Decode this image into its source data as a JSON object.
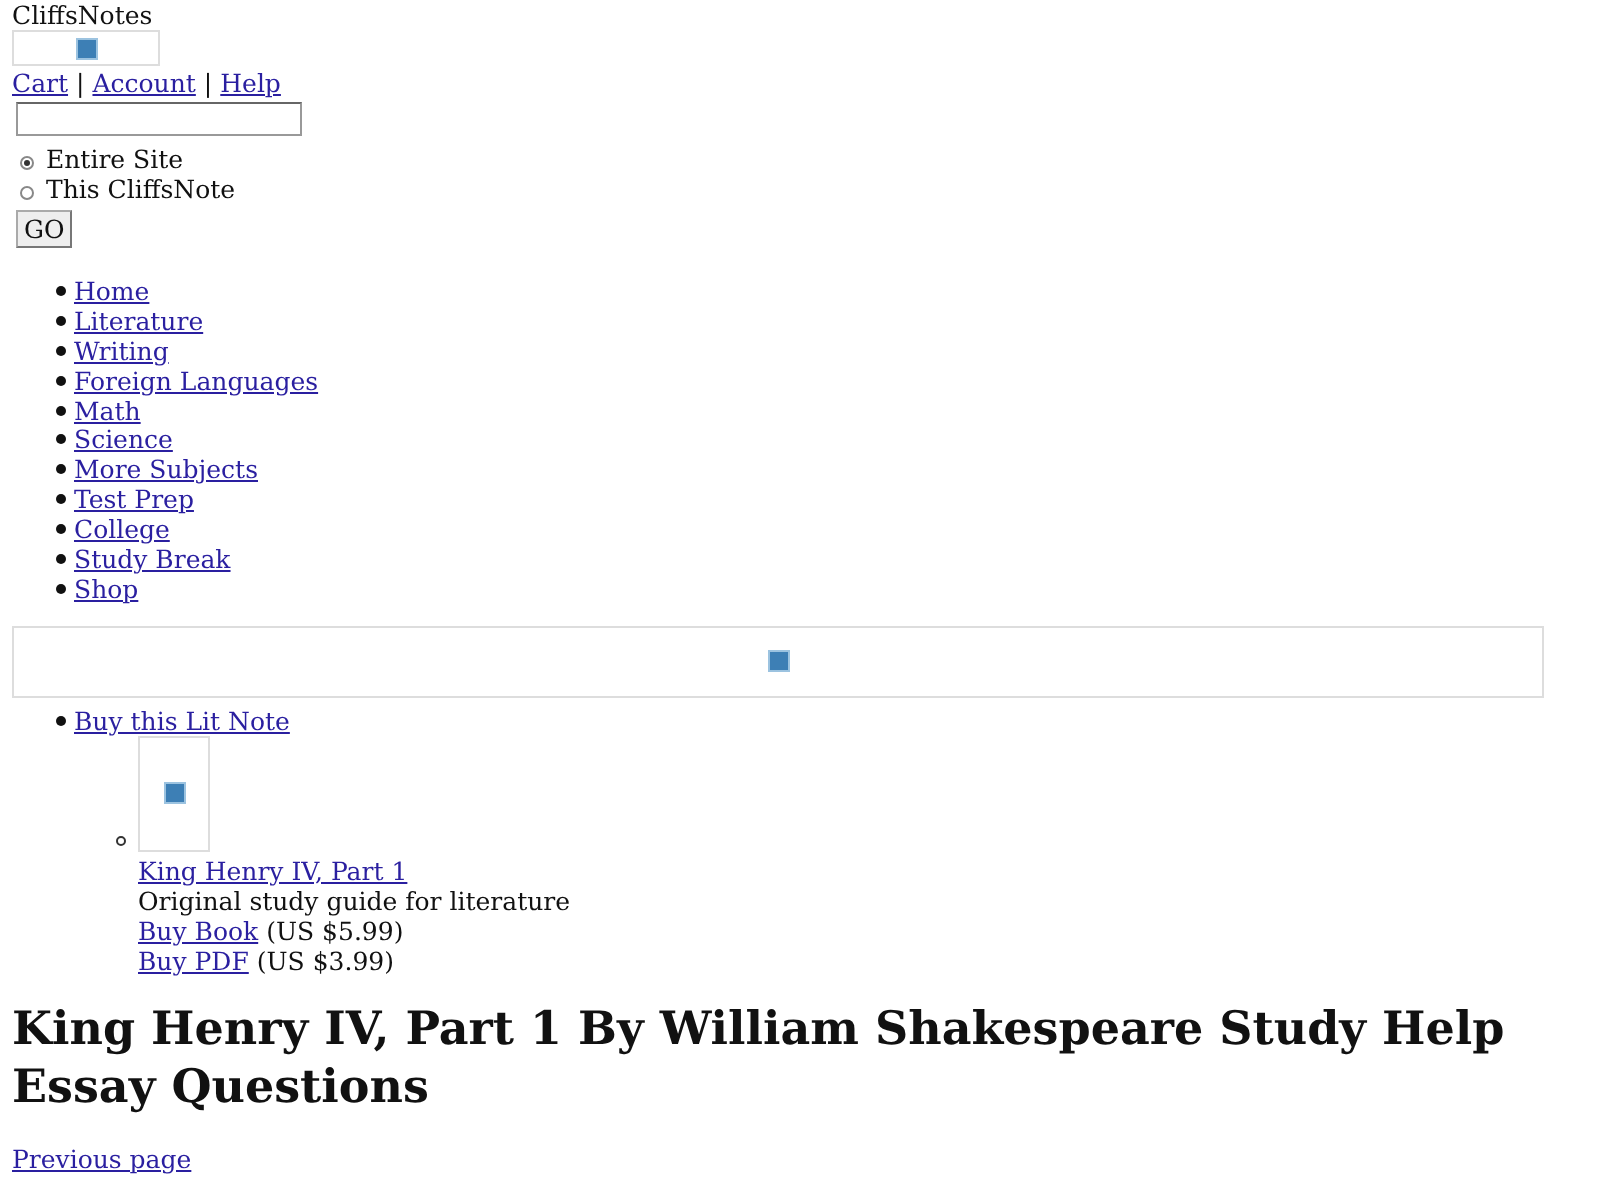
{
  "header": {
    "site_name": "CliffsNotes",
    "account_links": [
      "Cart",
      "Account",
      "Help"
    ],
    "separators": [
      "|",
      "|"
    ]
  },
  "search": {
    "scopes": [
      {
        "label": "Entire Site",
        "selected": true
      },
      {
        "label": "This CliffsNote",
        "selected": false
      }
    ],
    "button": "GO"
  },
  "nav": [
    "Home",
    "Literature",
    "Writing",
    "Foreign Languages",
    "Math",
    "Science",
    "More Subjects",
    "Test Prep",
    "College",
    "Study Break",
    "Shop"
  ],
  "buy": {
    "heading": "Buy this Lit Note",
    "product": {
      "title": "King Henry IV, Part 1",
      "description": "Original study guide for literature",
      "options": [
        {
          "link": "Buy Book",
          "price": "(US $5.99)"
        },
        {
          "link": "Buy PDF",
          "price": "(US $3.99)"
        }
      ]
    }
  },
  "title": "King Henry IV, Part 1 By William Shakespeare Study Help Essay Questions",
  "previous_link": "Previous page"
}
